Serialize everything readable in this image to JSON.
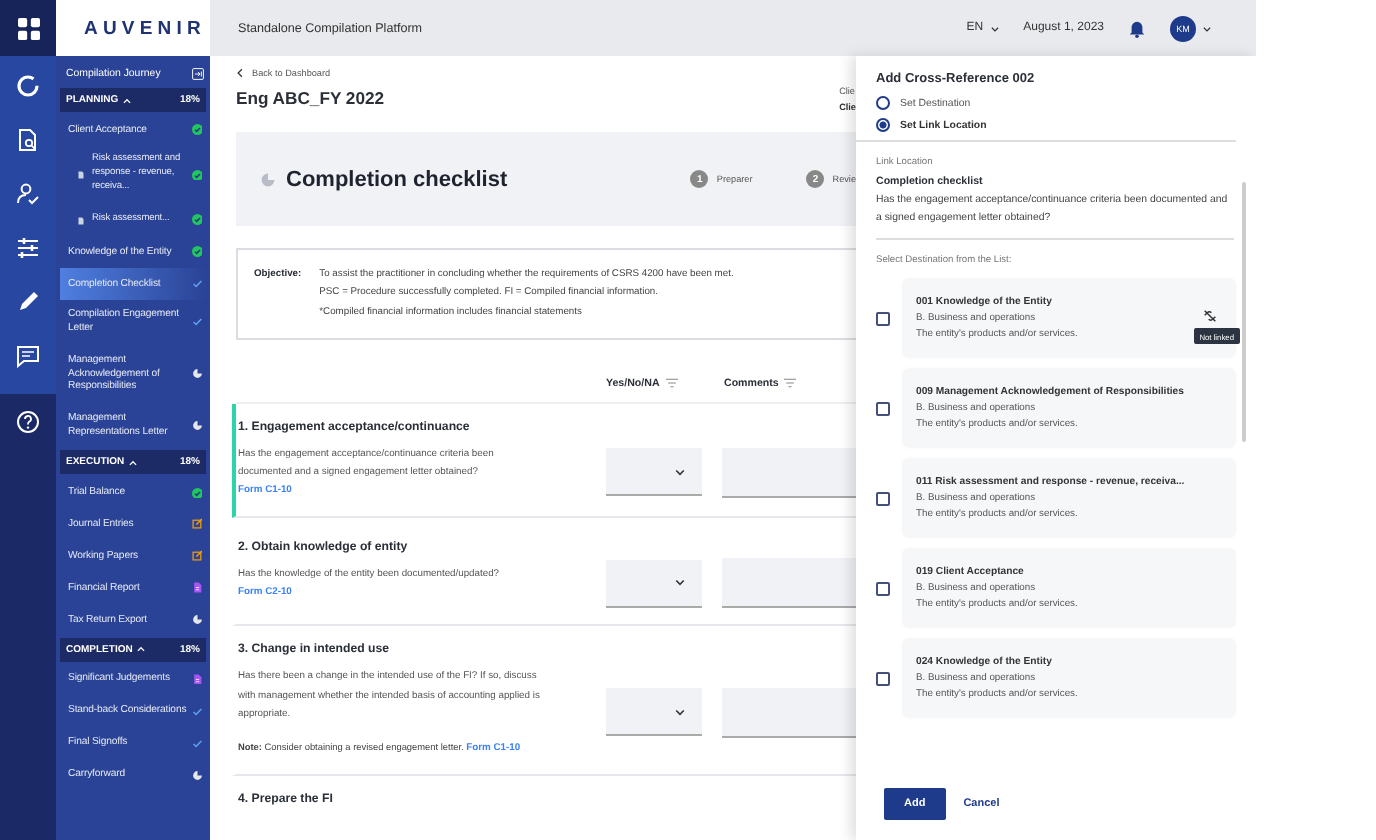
{
  "logo": "AUVENIR",
  "header": {
    "title": "Standalone Compilation Platform",
    "language": "EN",
    "date": "August 1, 2023",
    "avatar": "KM"
  },
  "sidebar": {
    "title": "Compilation Journey",
    "sections": [
      {
        "title": "PLANNING",
        "percent": "18%",
        "expanded": true,
        "items": [
          {
            "label": "Client Acceptance",
            "kind": "done",
            "selected": false,
            "children": [
              {
                "label": "Risk assessment and response - revenue, receiva...",
                "kind": "done",
                "selected": false
              },
              {
                "label": "Risk assessment...",
                "kind": "done",
                "selected": false
              }
            ]
          },
          {
            "label": "Knowledge of the Entity",
            "kind": "done",
            "selected": false
          },
          {
            "label": "Completion Checklist",
            "kind": "reviewed",
            "selected": true
          },
          {
            "label": "Compilation Engagement Letter",
            "kind": "reviewed",
            "selected": false
          },
          {
            "label": "Management Acknowledgement of Responsibilities",
            "kind": "pending",
            "selected": false
          },
          {
            "label": "Management Representations Letter",
            "kind": "pending",
            "selected": false
          }
        ]
      },
      {
        "title": "EXECUTION",
        "percent": "18%",
        "expanded": true,
        "items": [
          {
            "label": "Trial Balance",
            "kind": "done",
            "selected": false
          },
          {
            "label": "Journal Entries",
            "kind": "edit",
            "selected": false
          },
          {
            "label": "Working Papers",
            "kind": "edit",
            "selected": false
          },
          {
            "label": "Financial Report",
            "kind": "document",
            "selected": false
          },
          {
            "label": "Tax Return Export",
            "kind": "pending",
            "selected": false
          }
        ]
      },
      {
        "title": "COMPLETION",
        "percent": "18%",
        "expanded": true,
        "items": [
          {
            "label": "Significant Judgements",
            "kind": "document",
            "selected": false
          },
          {
            "label": "Stand-back Considerations",
            "kind": "reviewed",
            "selected": false
          },
          {
            "label": "Final Signoffs",
            "kind": "reviewed",
            "selected": false
          },
          {
            "label": "Carryforward",
            "kind": "pending",
            "selected": false
          }
        ]
      }
    ]
  },
  "page": {
    "back": "Back to Dashboard",
    "title": "Eng ABC_FY 2022",
    "client_lines": [
      "Clie",
      "Clie"
    ],
    "checklist_title": "Completion checklist",
    "steps": [
      {
        "number": "1",
        "label": "Preparer"
      },
      {
        "number": "2",
        "label": "Revie"
      }
    ],
    "objective": {
      "label": "Objective:",
      "lines": [
        "To assist the practitioner in concluding whether the requirements of CSRS 4200 have been met.",
        "PSC = Procedure successfully completed. FI = Compiled financial information.",
        "*Compiled financial information includes financial statements"
      ]
    },
    "columns": [
      "Yes/No/NA",
      "Comments"
    ],
    "rows": [
      {
        "title": "1. Engagement acceptance/continuance",
        "question": "Has the engagement acceptance/continuance criteria been documented and a signed engagement letter obtained?",
        "link": "Form C1-10",
        "active": true
      },
      {
        "title": "2. Obtain knowledge of entity",
        "question": "Has the knowledge of the entity been documented/updated?",
        "link": "Form C2-10",
        "active": false
      },
      {
        "title": "3. Change in intended use",
        "question": "Has there been a change in the intended use of the FI? If so, discuss with management whether the intended basis of accounting applied is appropriate.",
        "note": "**Note:** Consider obtaining a revised engagement letter.",
        "note_link": "Form C1-10",
        "active": false
      },
      {
        "title": "4. Prepare the FI",
        "active": false
      }
    ]
  },
  "panel": {
    "title": "Add Cross-Reference 002",
    "options": [
      {
        "label": "Set Destination",
        "selected": false
      },
      {
        "label": "Set Link Location",
        "selected": true
      }
    ],
    "link_label": "Link Location",
    "link_title": "Completion checklist",
    "link_text": "Has the engagement acceptance/continuance criteria been documented and a signed engagement letter obtained?",
    "list_label": "Select Destination from the List:",
    "destinations": [
      {
        "title": "001 Knowledge of the Entity",
        "section": "B. Business and operations",
        "description": "The entity's products and/or services.",
        "checked": false,
        "tooltip": "Not linked"
      },
      {
        "title": "009 Management Acknowledgement of Responsibilities",
        "section": "B. Business and operations",
        "description": "The entity's products and/or services.",
        "checked": false
      },
      {
        "title": "011 Risk assessment and response - revenue, receiva...",
        "section": "B. Business and operations",
        "description": "The entity's products and/or services.",
        "checked": false
      },
      {
        "title": "019 Client Acceptance",
        "section": "B. Business and operations",
        "description": "The entity's products and/or services.",
        "checked": false
      },
      {
        "title": "024 Knowledge of the Entity",
        "section": "B. Business and operations",
        "description": "The entity's products and/or services.",
        "checked": false
      }
    ],
    "buttons": {
      "primary": "Add",
      "secondary": "Cancel"
    }
  }
}
